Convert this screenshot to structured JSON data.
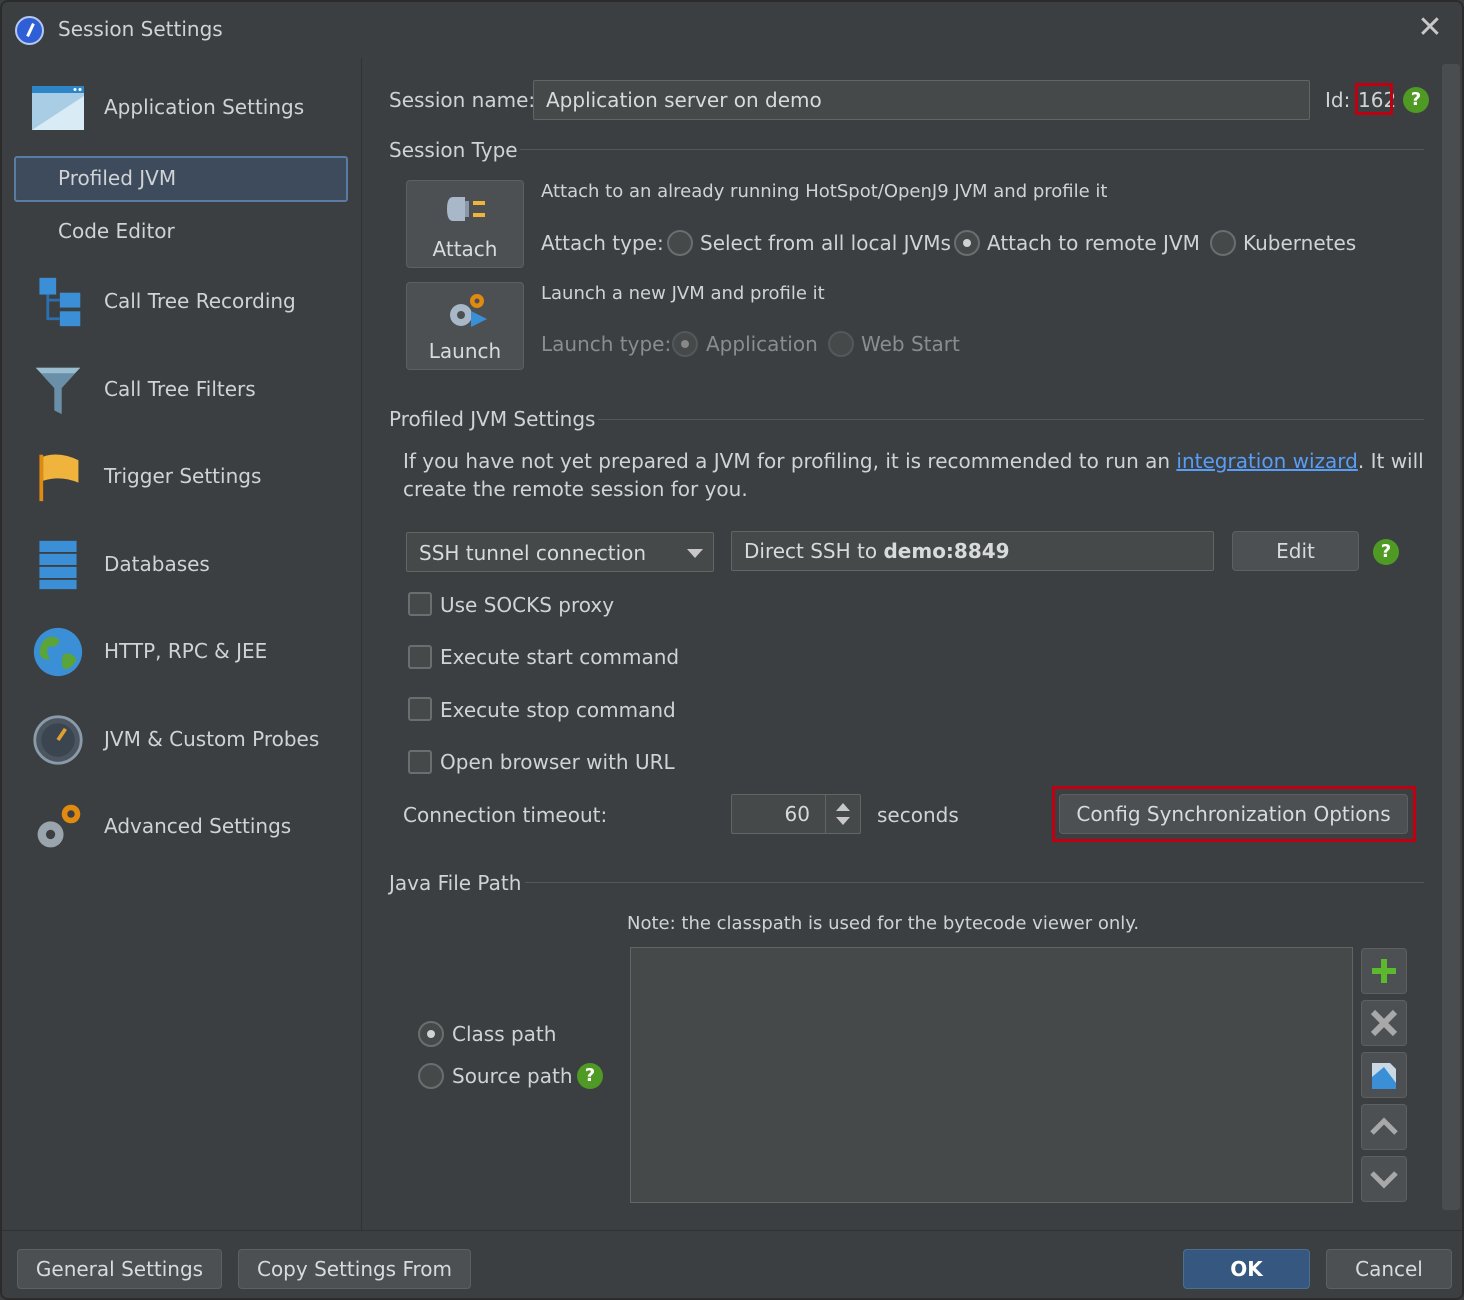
{
  "window": {
    "title": "Session Settings"
  },
  "sidebar": {
    "items": [
      {
        "label": "Application Settings"
      },
      {
        "label": "Profiled JVM"
      },
      {
        "label": "Code Editor"
      },
      {
        "label": "Call Tree Recording"
      },
      {
        "label": "Call Tree Filters"
      },
      {
        "label": "Trigger Settings"
      },
      {
        "label": "Databases"
      },
      {
        "label": "HTTP, RPC & JEE"
      },
      {
        "label": "JVM & Custom Probes"
      },
      {
        "label": "Advanced Settings"
      }
    ],
    "selected": "Profiled JVM"
  },
  "session": {
    "name_label": "Session name:",
    "name_value": "Application server on demo",
    "id_label": "Id:",
    "id_value": "162"
  },
  "session_type": {
    "heading": "Session Type",
    "attach_button": "Attach",
    "attach_desc": "Attach to an already running HotSpot/OpenJ9 JVM and profile it",
    "attach_type_label": "Attach type:",
    "attach_options": [
      "Select from all local JVMs",
      "Attach to remote JVM",
      "Kubernetes"
    ],
    "attach_selected": "Attach to remote JVM",
    "launch_button": "Launch",
    "launch_desc": "Launch a new JVM and profile it",
    "launch_type_label": "Launch type:",
    "launch_options": [
      "Application",
      "Web Start"
    ],
    "launch_selected": "Application"
  },
  "jvm_settings": {
    "heading": "Profiled JVM Settings",
    "info_before": "If you have not yet prepared a JVM for profiling, it is recommended to run an ",
    "info_link": "integration wizard",
    "info_after": ". It will",
    "info_line2": "create the remote session for you.",
    "connection_type": "SSH tunnel connection",
    "connection_prefix": "Direct SSH to ",
    "connection_host": "demo:8849",
    "edit_button": "Edit",
    "checkboxes": [
      "Use SOCKS proxy",
      "Execute start command",
      "Execute stop command",
      "Open browser with URL"
    ],
    "timeout_label": "Connection timeout:",
    "timeout_value": "60",
    "timeout_unit": "seconds",
    "config_sync_button": "Config Synchronization Options"
  },
  "java_file_path": {
    "heading": "Java File Path",
    "note": "Note: the classpath is used for the bytecode viewer only.",
    "options": [
      "Class path",
      "Source path"
    ],
    "selected": "Class path"
  },
  "footer": {
    "general_settings": "General Settings",
    "copy_settings": "Copy Settings From",
    "ok": "OK",
    "cancel": "Cancel"
  },
  "colors": {
    "accent": "#365880",
    "highlight": "#c00010",
    "help": "#4e9a25",
    "link": "#589df6"
  }
}
